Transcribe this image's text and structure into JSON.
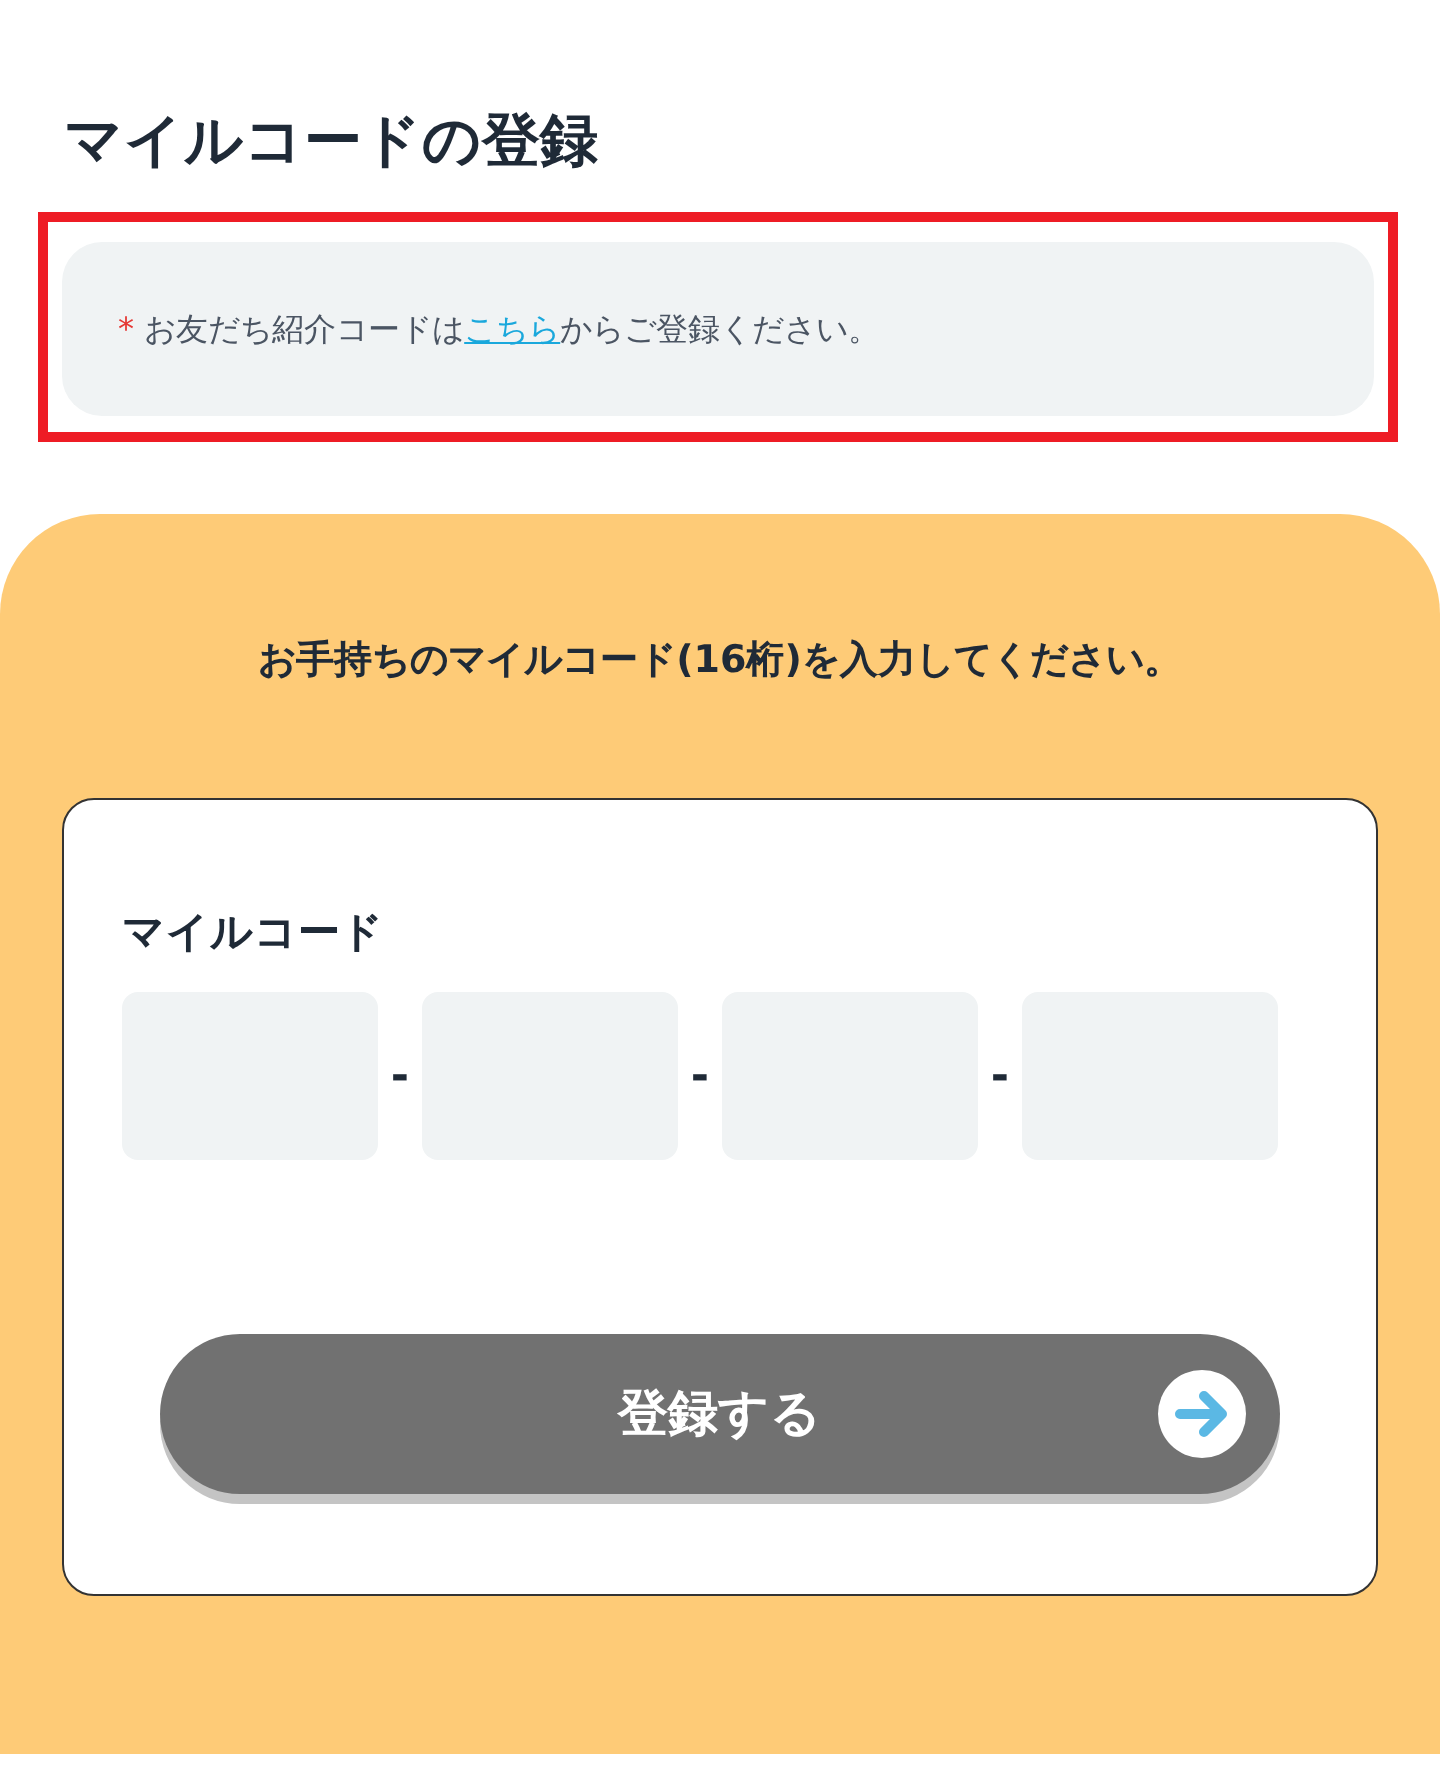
{
  "title": "マイルコードの登録",
  "notice": {
    "asterisk": "*",
    "text_before": " お友だち紹介コードは",
    "link": "こちら",
    "text_after": "からご登録ください。"
  },
  "instruction": "お手持ちのマイルコード(16桁)を入力してください。",
  "form": {
    "label": "マイルコード",
    "fields": [
      {
        "kind": "input"
      },
      {
        "kind": "input"
      },
      {
        "kind": "input"
      },
      {
        "kind": "input"
      }
    ],
    "separators": [
      "-",
      "-",
      "-"
    ],
    "submit": {
      "label": "登録する",
      "disabled": true
    }
  }
}
